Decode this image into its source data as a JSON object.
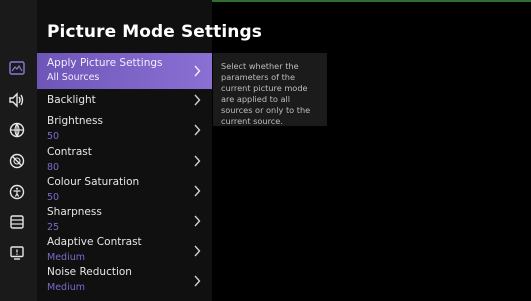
{
  "panel": {
    "title": "Picture Mode Settings"
  },
  "sidebar": {
    "icons": [
      "picture-icon",
      "sound-icon",
      "network-globe-icon",
      "no-sign-icon",
      "accessibility-icon",
      "list-icon",
      "support-icon"
    ]
  },
  "menu": {
    "items": [
      {
        "label": "Apply Picture Settings",
        "value": "All Sources"
      },
      {
        "label": "Backlight",
        "value": ""
      },
      {
        "label": "Brightness",
        "value": "50"
      },
      {
        "label": "Contrast",
        "value": "80"
      },
      {
        "label": "Colour Saturation",
        "value": "50"
      },
      {
        "label": "Sharpness",
        "value": "25"
      },
      {
        "label": "Adaptive Contrast",
        "value": "Medium"
      },
      {
        "label": "Noise Reduction",
        "value": "Medium"
      }
    ]
  },
  "tooltip": {
    "text": "Select whether the parameters of the current picture mode are applied to all sources or only to the current source."
  },
  "colors": {
    "selected": "#7b63c8",
    "accent": "#7d69c9"
  }
}
